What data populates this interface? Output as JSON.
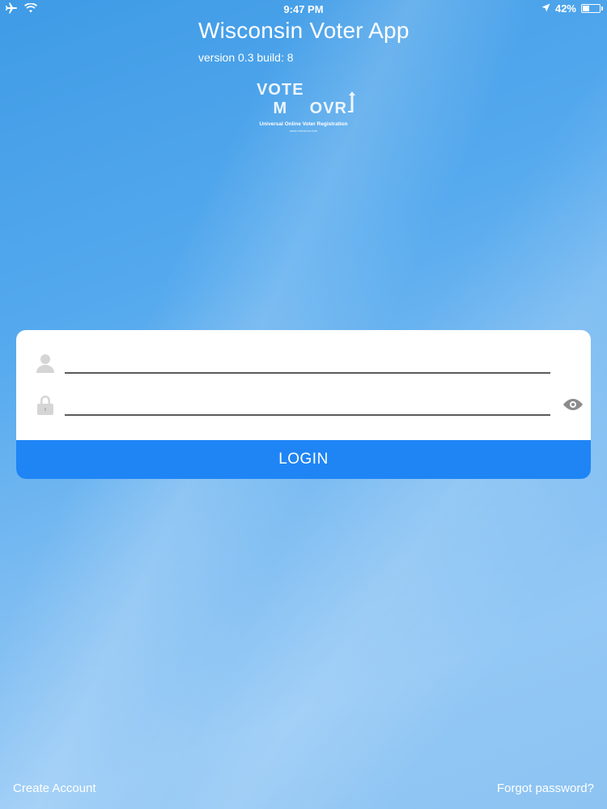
{
  "status_bar": {
    "time": "9:47 PM",
    "battery_percent": "42%",
    "battery_level": 0.42,
    "icons": [
      "airplane-icon",
      "wifi-icon",
      "location-arrow-icon",
      "battery-icon"
    ]
  },
  "header": {
    "title": "Wisconsin Voter App",
    "version": "version 0.3 build: 8"
  },
  "logo": {
    "word_left": "VOTE M",
    "word_right": "OVR",
    "tagline": "Universal Online Voter Registration",
    "url": "www.votemovr.com"
  },
  "login": {
    "username_value": "",
    "username_placeholder": "",
    "password_value": "",
    "password_placeholder": "",
    "button_label": "LOGIN",
    "icons": [
      "user-icon",
      "lock-icon",
      "eye-icon"
    ]
  },
  "footer": {
    "create_account": "Create Account",
    "forgot_password": "Forgot password?"
  },
  "colors": {
    "accent": "#1f85f5",
    "background": "#56aaee",
    "card": "#ffffff",
    "icon_gray": "#d5d5d5"
  }
}
